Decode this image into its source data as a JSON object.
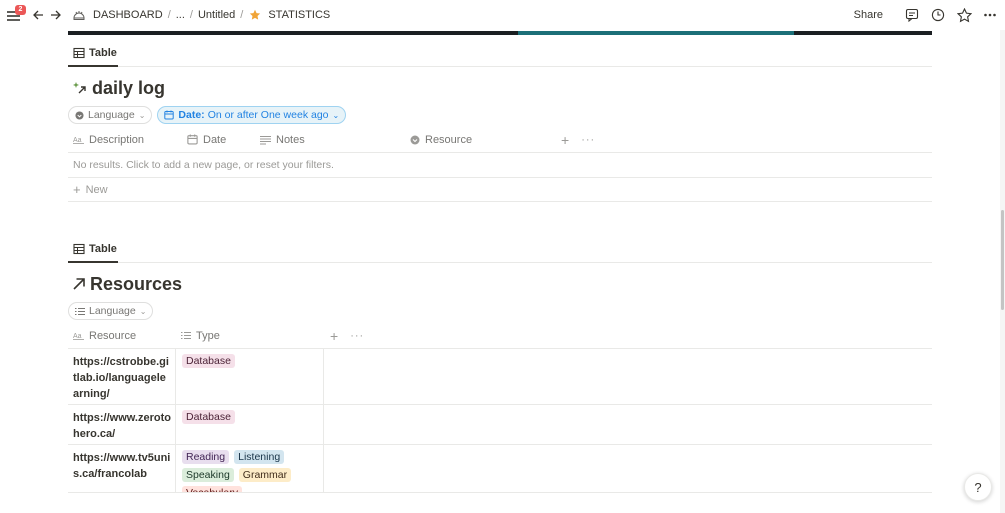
{
  "topbar": {
    "notification_count": "2",
    "breadcrumbs": [
      "DASHBOARD",
      "...",
      "Untitled",
      "STATISTICS"
    ],
    "share_label": "Share"
  },
  "daily_log": {
    "view_tab": "Table",
    "title": "daily log",
    "filters": {
      "language": "Language",
      "date_prefix": "Date:",
      "date_value": "On or after One week ago"
    },
    "columns": [
      "Description",
      "Date",
      "Notes",
      "Resource"
    ],
    "empty_message": "No results. Click to add a new page, or reset your filters.",
    "new_label": "New"
  },
  "resources": {
    "view_tab": "Table",
    "title": "Resources",
    "filters": {
      "language": "Language"
    },
    "columns": [
      "Resource",
      "Type"
    ],
    "rows": [
      {
        "resource": "https://cstrobbe.gitlab.io/languagelearning/",
        "types": [
          "Database"
        ]
      },
      {
        "resource": "https://www.zerotohero.ca/",
        "types": [
          "Database"
        ]
      },
      {
        "resource": "https://www.tv5unis.ca/francolab",
        "types": [
          "Reading",
          "Listening",
          "Speaking",
          "Grammar",
          "Vocabulary"
        ]
      }
    ]
  },
  "tag_colors": {
    "Database": {
      "bg": "#f5e0e9",
      "fg": "#4c2337"
    },
    "Reading": {
      "bg": "#e8deee",
      "fg": "#412454"
    },
    "Listening": {
      "bg": "#d3e5ef",
      "fg": "#183347"
    },
    "Speaking": {
      "bg": "#dbeddb",
      "fg": "#1c3829"
    },
    "Grammar": {
      "bg": "#fdecc8",
      "fg": "#402c1b"
    },
    "Vocabulary": {
      "bg": "#ffe2dd",
      "fg": "#5d1715"
    }
  },
  "help_label": "?"
}
